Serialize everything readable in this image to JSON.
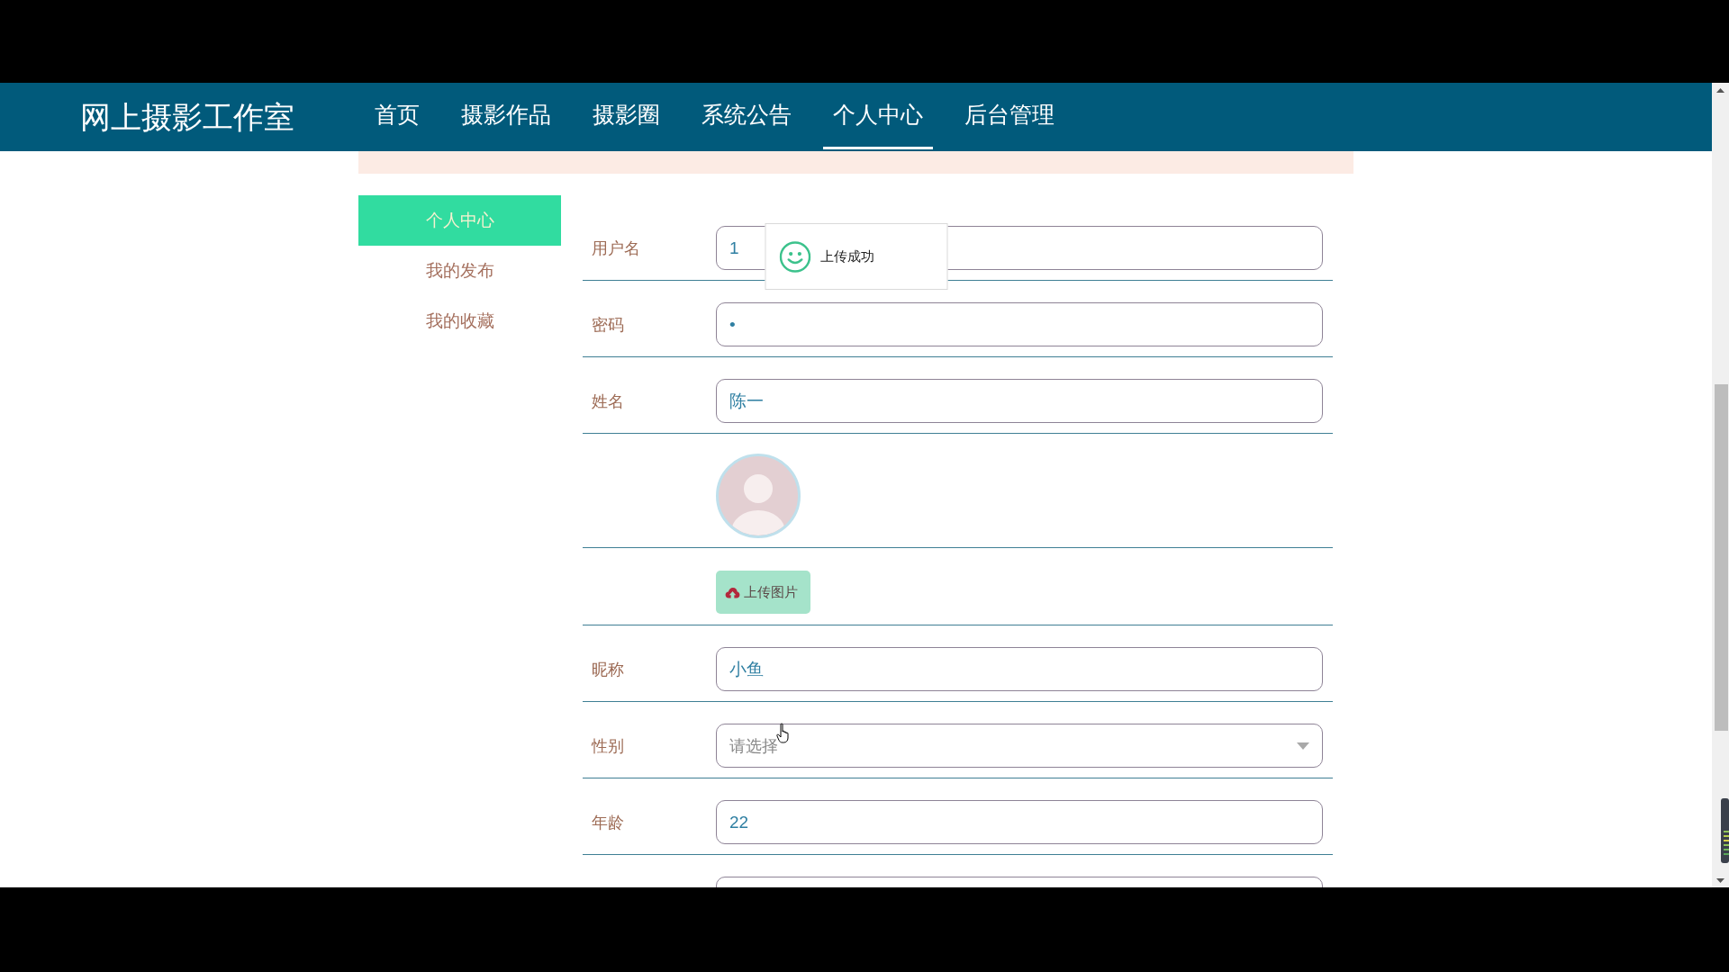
{
  "header": {
    "logo": "网上摄影工作室",
    "nav": [
      {
        "label": "首页",
        "selected": false
      },
      {
        "label": "摄影作品",
        "selected": false
      },
      {
        "label": "摄影圈",
        "selected": false
      },
      {
        "label": "系统公告",
        "selected": false
      },
      {
        "label": "个人中心",
        "selected": true
      },
      {
        "label": "后台管理",
        "selected": false
      }
    ]
  },
  "sidebar": {
    "items": [
      {
        "label": "个人中心",
        "selected": true
      },
      {
        "label": "我的发布",
        "selected": false
      },
      {
        "label": "我的收藏",
        "selected": false
      }
    ]
  },
  "form": {
    "rows": [
      {
        "kind": "input",
        "label": "用户名",
        "value": "1"
      },
      {
        "kind": "input",
        "label": "密码",
        "value": "•"
      },
      {
        "kind": "input",
        "label": "姓名",
        "value": "陈一"
      },
      {
        "kind": "avatar"
      },
      {
        "kind": "upload",
        "button": "上传图片"
      },
      {
        "kind": "input",
        "label": "昵称",
        "value": "小鱼"
      },
      {
        "kind": "select",
        "label": "性别",
        "placeholder": "请选择"
      },
      {
        "kind": "input",
        "label": "年龄",
        "value": "22"
      },
      {
        "kind": "input"
      }
    ]
  },
  "toast": {
    "message": "上传成功"
  }
}
